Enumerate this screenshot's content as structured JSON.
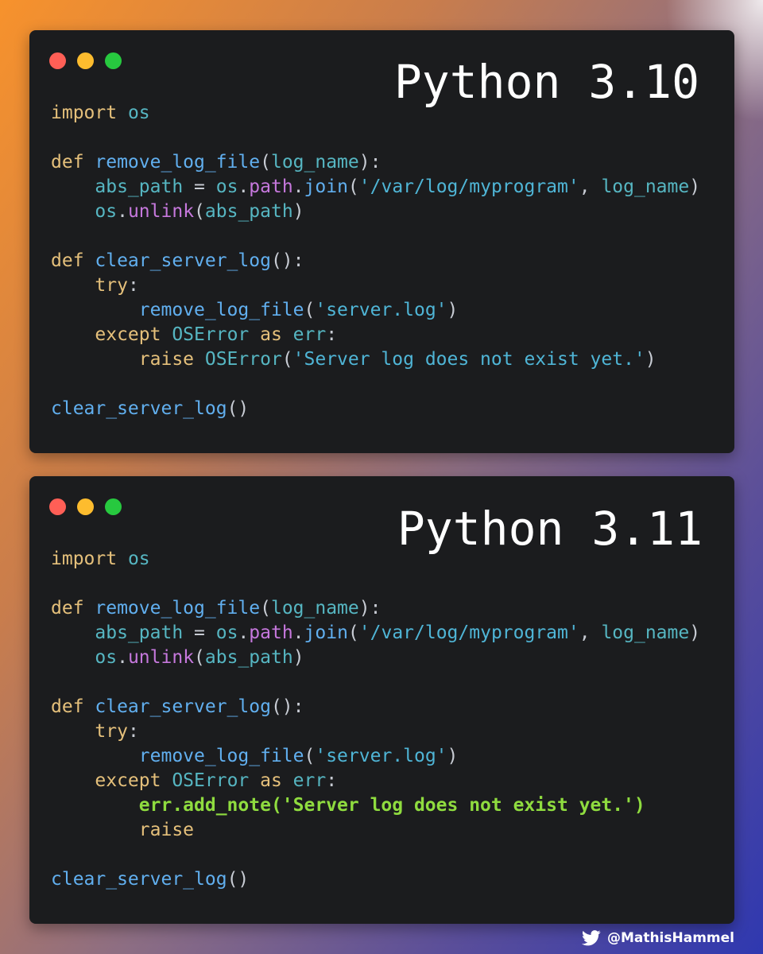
{
  "panel_310": {
    "title": "Python 3.10",
    "lines": [
      [
        {
          "t": "import",
          "c": "kw"
        },
        {
          "t": " os",
          "c": "nm"
        }
      ],
      [],
      [
        {
          "t": "def",
          "c": "kw"
        },
        {
          "t": " remove_log_file",
          "c": "fn"
        },
        {
          "t": "(",
          "c": "pu"
        },
        {
          "t": "log_name",
          "c": "nm"
        },
        {
          "t": "):",
          "c": "pu"
        }
      ],
      [
        {
          "t": "    abs_path",
          "c": "nm"
        },
        {
          "t": " = ",
          "c": "pu"
        },
        {
          "t": "os",
          "c": "nm"
        },
        {
          "t": ".",
          "c": "pu"
        },
        {
          "t": "path",
          "c": "at"
        },
        {
          "t": ".",
          "c": "pu"
        },
        {
          "t": "join",
          "c": "fn"
        },
        {
          "t": "(",
          "c": "pu"
        },
        {
          "t": "'/var/log/myprogram'",
          "c": "st"
        },
        {
          "t": ", ",
          "c": "pu"
        },
        {
          "t": "log_name",
          "c": "nm"
        },
        {
          "t": ")",
          "c": "pu"
        }
      ],
      [
        {
          "t": "    os",
          "c": "nm"
        },
        {
          "t": ".",
          "c": "pu"
        },
        {
          "t": "unlink",
          "c": "at"
        },
        {
          "t": "(",
          "c": "pu"
        },
        {
          "t": "abs_path",
          "c": "nm"
        },
        {
          "t": ")",
          "c": "pu"
        }
      ],
      [],
      [
        {
          "t": "def",
          "c": "kw"
        },
        {
          "t": " clear_server_log",
          "c": "fn"
        },
        {
          "t": "():",
          "c": "pu"
        }
      ],
      [
        {
          "t": "    try",
          "c": "kw"
        },
        {
          "t": ":",
          "c": "pu"
        }
      ],
      [
        {
          "t": "        remove_log_file",
          "c": "fn"
        },
        {
          "t": "(",
          "c": "pu"
        },
        {
          "t": "'server.log'",
          "c": "st"
        },
        {
          "t": ")",
          "c": "pu"
        }
      ],
      [
        {
          "t": "    except",
          "c": "kw"
        },
        {
          "t": " OSError",
          "c": "nm"
        },
        {
          "t": " as",
          "c": "kw"
        },
        {
          "t": " err",
          "c": "nm"
        },
        {
          "t": ":",
          "c": "pu"
        }
      ],
      [
        {
          "t": "        raise",
          "c": "kw"
        },
        {
          "t": " OSError",
          "c": "nm"
        },
        {
          "t": "(",
          "c": "pu"
        },
        {
          "t": "'Server log does not exist yet.'",
          "c": "st"
        },
        {
          "t": ")",
          "c": "pu"
        }
      ],
      [],
      [
        {
          "t": "clear_server_log",
          "c": "fn"
        },
        {
          "t": "()",
          "c": "pu"
        }
      ]
    ]
  },
  "panel_311": {
    "title": "Python 3.11",
    "lines": [
      [
        {
          "t": "import",
          "c": "kw"
        },
        {
          "t": " os",
          "c": "nm"
        }
      ],
      [],
      [
        {
          "t": "def",
          "c": "kw"
        },
        {
          "t": " remove_log_file",
          "c": "fn"
        },
        {
          "t": "(",
          "c": "pu"
        },
        {
          "t": "log_name",
          "c": "nm"
        },
        {
          "t": "):",
          "c": "pu"
        }
      ],
      [
        {
          "t": "    abs_path",
          "c": "nm"
        },
        {
          "t": " = ",
          "c": "pu"
        },
        {
          "t": "os",
          "c": "nm"
        },
        {
          "t": ".",
          "c": "pu"
        },
        {
          "t": "path",
          "c": "at"
        },
        {
          "t": ".",
          "c": "pu"
        },
        {
          "t": "join",
          "c": "fn"
        },
        {
          "t": "(",
          "c": "pu"
        },
        {
          "t": "'/var/log/myprogram'",
          "c": "st"
        },
        {
          "t": ", ",
          "c": "pu"
        },
        {
          "t": "log_name",
          "c": "nm"
        },
        {
          "t": ")",
          "c": "pu"
        }
      ],
      [
        {
          "t": "    os",
          "c": "nm"
        },
        {
          "t": ".",
          "c": "pu"
        },
        {
          "t": "unlink",
          "c": "at"
        },
        {
          "t": "(",
          "c": "pu"
        },
        {
          "t": "abs_path",
          "c": "nm"
        },
        {
          "t": ")",
          "c": "pu"
        }
      ],
      [],
      [
        {
          "t": "def",
          "c": "kw"
        },
        {
          "t": " clear_server_log",
          "c": "fn"
        },
        {
          "t": "():",
          "c": "pu"
        }
      ],
      [
        {
          "t": "    try",
          "c": "kw"
        },
        {
          "t": ":",
          "c": "pu"
        }
      ],
      [
        {
          "t": "        remove_log_file",
          "c": "fn"
        },
        {
          "t": "(",
          "c": "pu"
        },
        {
          "t": "'server.log'",
          "c": "st"
        },
        {
          "t": ")",
          "c": "pu"
        }
      ],
      [
        {
          "t": "    except",
          "c": "kw"
        },
        {
          "t": " OSError",
          "c": "nm"
        },
        {
          "t": " as",
          "c": "kw"
        },
        {
          "t": " err",
          "c": "nm"
        },
        {
          "t": ":",
          "c": "pu"
        }
      ],
      [
        {
          "t": "        err.add_note('Server log does not exist yet.')",
          "c": "hl"
        }
      ],
      [
        {
          "t": "        raise",
          "c": "kw"
        }
      ],
      [],
      [
        {
          "t": "clear_server_log",
          "c": "fn"
        },
        {
          "t": "()",
          "c": "pu"
        }
      ]
    ]
  },
  "credit": {
    "handle": "@MathisHammel",
    "icon": "twitter-icon"
  },
  "colors": {
    "keyword": "#e5c07b",
    "function": "#61afef",
    "name": "#56b6c2",
    "punctuation": "#c8ccd4",
    "attribute": "#c678dd",
    "string": "#4fb5d6",
    "highlight": "#8fdc3f",
    "window_bg": "#1b1c1e"
  }
}
